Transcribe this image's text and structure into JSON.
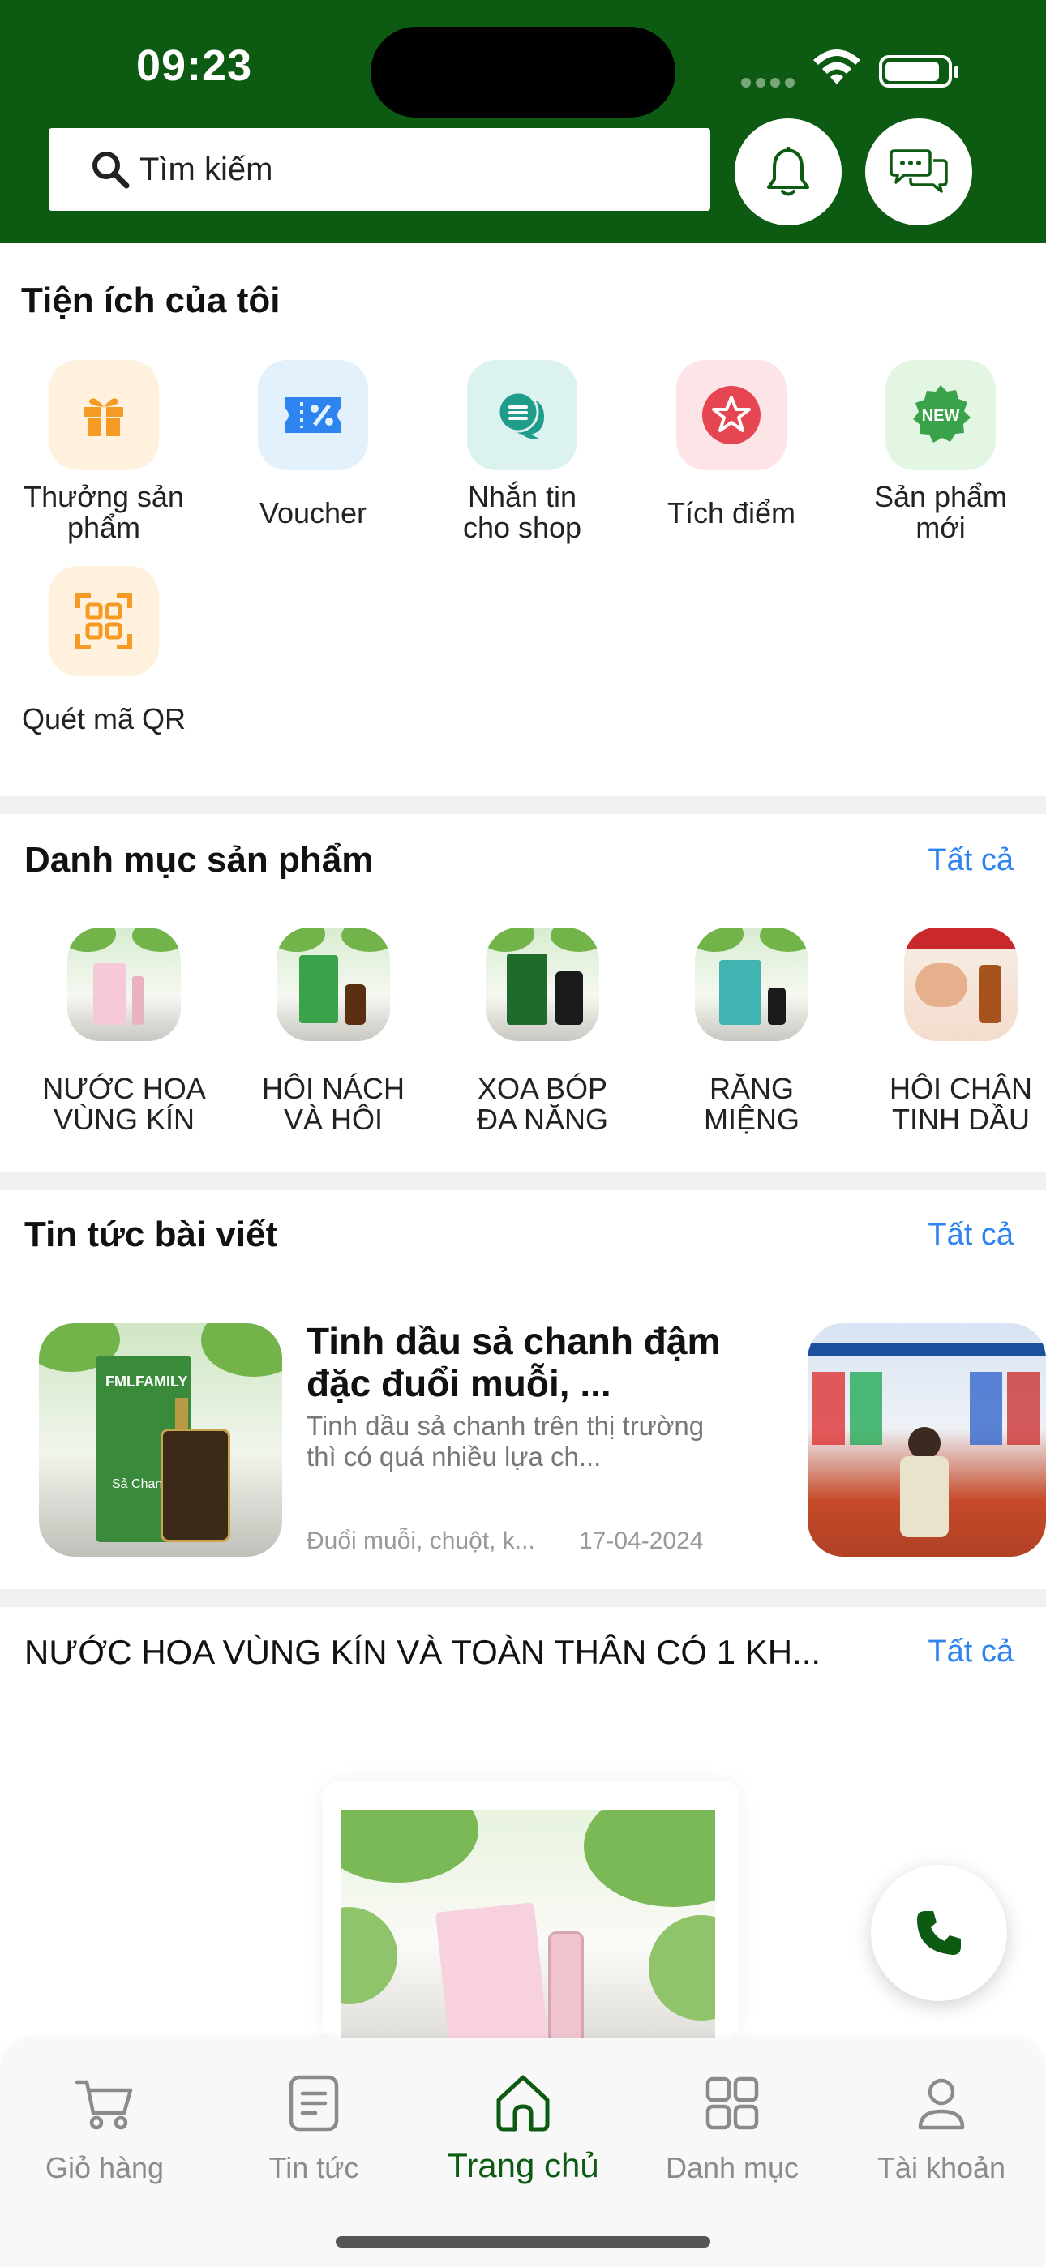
{
  "status_bar": {
    "time": "09:23"
  },
  "search": {
    "placeholder": "Tìm kiếm"
  },
  "utilities": {
    "title": "Tiện ích của tôi",
    "items": [
      {
        "label": "Thưởng sản\nphẩm",
        "icon": "gift-icon",
        "color": "#f59a23"
      },
      {
        "label": "Voucher",
        "icon": "voucher-icon",
        "color": "#2d83f0"
      },
      {
        "label": "Nhắn tin\ncho shop",
        "icon": "chat-bubble-icon",
        "color": "#1f9c8a"
      },
      {
        "label": "Tích điểm",
        "icon": "star-icon",
        "color": "#e64552"
      },
      {
        "label": "Sản phẩm\nmới",
        "icon": "new-badge-icon",
        "color": "#3aa34a"
      },
      {
        "label": "Quét mã QR",
        "icon": "qr-scan-icon",
        "color": "#f59a23"
      }
    ]
  },
  "categories": {
    "title": "Danh mục sản phẩm",
    "see_all": "Tất cả",
    "items": [
      {
        "label": "NƯỚC HOA\nVÙNG KÍN"
      },
      {
        "label": "HÔI NÁCH\nVÀ HÔI"
      },
      {
        "label": "XOA BÓP\nĐA NĂNG"
      },
      {
        "label": "RĂNG\nMIỆNG"
      },
      {
        "label": "HÔI CHÂN\nTINH DẦU"
      }
    ]
  },
  "news": {
    "title": "Tin tức bài viết",
    "see_all": "Tất cả",
    "items": [
      {
        "title": "Tinh dầu sả chanh đậm đặc đuổi muỗi, ...",
        "description": "Tinh dầu sả chanh trên thị trường thì có quá nhiều lựa ch...",
        "tag": "Đuổi muỗi, chuột, k...",
        "date": "17-04-2024",
        "image_brand": "FMLFAMILY",
        "image_product": "Sả Chanh"
      }
    ]
  },
  "product_section": {
    "title": "NƯỚC HOA VÙNG KÍN VÀ TOÀN THÂN CÓ 1 KH...",
    "see_all": "Tất cả"
  },
  "tabbar": {
    "items": [
      {
        "label": "Giỏ hàng",
        "icon": "cart-icon"
      },
      {
        "label": "Tin tức",
        "icon": "news-icon"
      },
      {
        "label": "Trang chủ",
        "icon": "home-icon",
        "active": true
      },
      {
        "label": "Danh mục",
        "icon": "grid-icon"
      },
      {
        "label": "Tài khoản",
        "icon": "user-icon"
      }
    ]
  },
  "colors": {
    "brand_green": "#0d5b12",
    "link_blue": "#2d83f0"
  }
}
